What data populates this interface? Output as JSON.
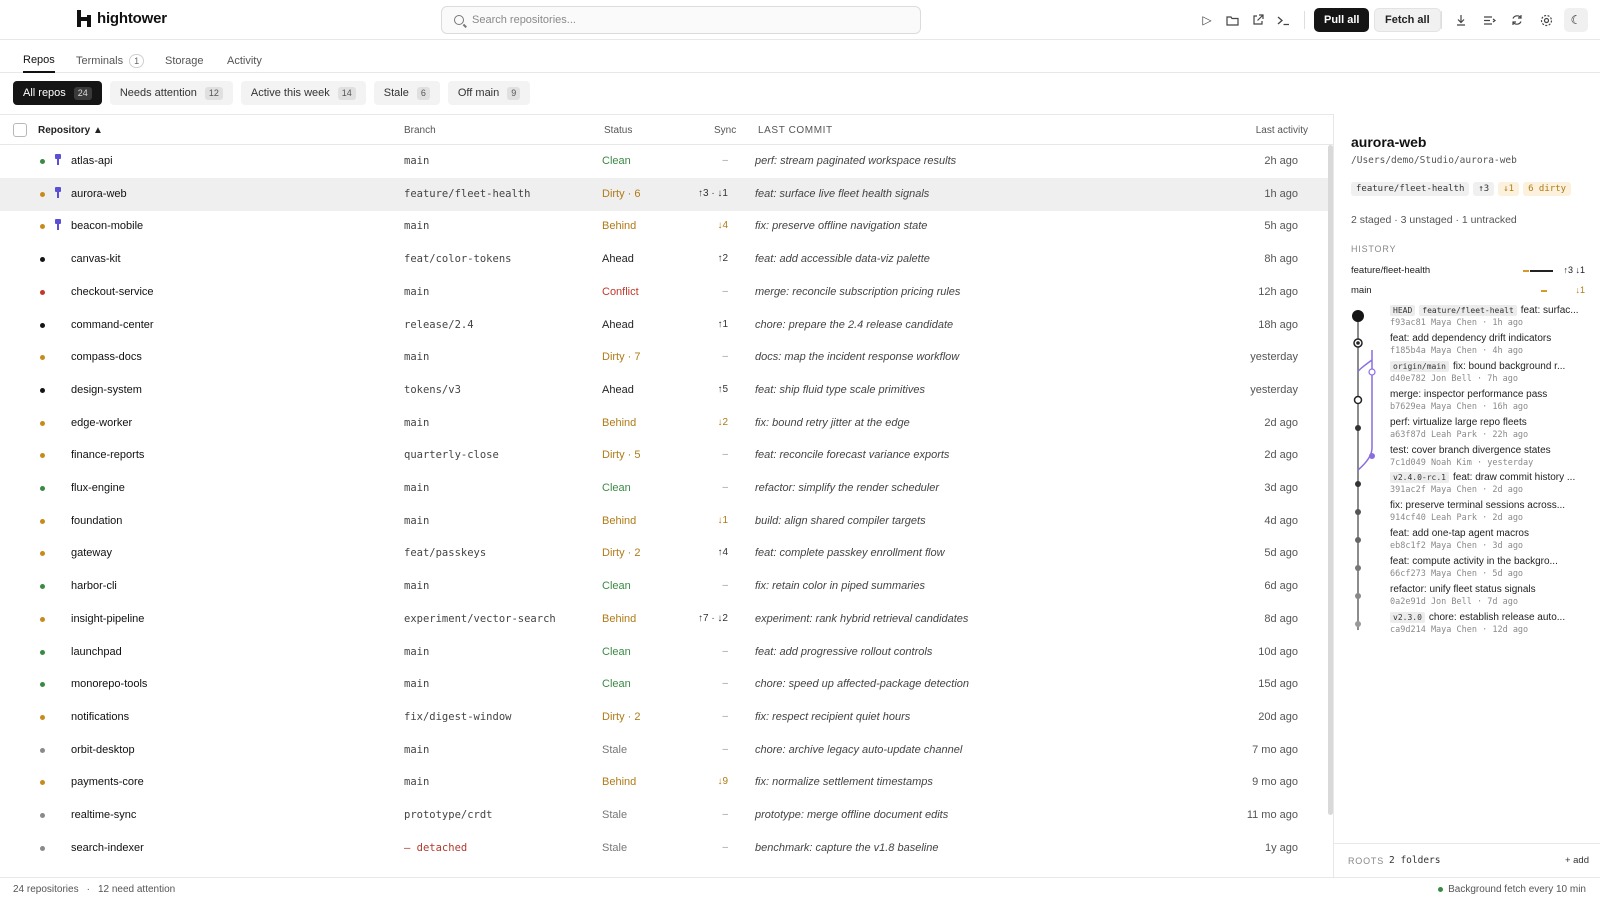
{
  "app": {
    "name": "hightower"
  },
  "search": {
    "placeholder": "Search repositories..."
  },
  "toolbar": {
    "pull_all": "Pull all",
    "fetch_all": "Fetch all",
    "icons": [
      "play-icon",
      "folder-icon",
      "external-link-icon",
      "terminal-icon",
      "download-icon",
      "list-icon",
      "refresh-icon",
      "gear-icon",
      "moon-icon"
    ]
  },
  "tabs": [
    {
      "label": "Repos",
      "active": true,
      "badge": ""
    },
    {
      "label": "Terminals",
      "active": false,
      "badge": "1"
    },
    {
      "label": "Storage",
      "active": false,
      "badge": ""
    },
    {
      "label": "Activity",
      "active": false,
      "badge": ""
    }
  ],
  "filters": [
    {
      "label": "All repos",
      "count": "24",
      "active": true
    },
    {
      "label": "Needs attention",
      "count": "12",
      "active": false
    },
    {
      "label": "Active this week",
      "count": "14",
      "active": false
    },
    {
      "label": "Stale",
      "count": "6",
      "active": false
    },
    {
      "label": "Off main",
      "count": "9",
      "active": false
    }
  ],
  "table": {
    "columns": {
      "repository": "Repository ▲",
      "branch": "Branch",
      "status": "Status",
      "sync": "Sync",
      "last_commit": "LAST COMMIT",
      "last_activity": "Last activity"
    },
    "rows": [
      {
        "name": "atlas-api",
        "pinned": true,
        "dot": "#3a8a44",
        "branch": "main",
        "status": "Clean",
        "kind": "clean",
        "sync": "–",
        "message": "perf: stream paginated workspace results",
        "activity": "2h ago"
      },
      {
        "name": "aurora-web",
        "pinned": true,
        "dot": "#c98a1c",
        "branch": "feature/fleet-health",
        "status": "Dirty · 6",
        "kind": "dirty",
        "sync": "↑3 · ↓1",
        "message": "feat: surface live fleet health signals",
        "activity": "1h ago",
        "selected": true
      },
      {
        "name": "beacon-mobile",
        "pinned": true,
        "dot": "#c98a1c",
        "branch": "main",
        "status": "Behind",
        "kind": "behind",
        "sync": "↓4",
        "message": "fix: preserve offline navigation state",
        "activity": "5h ago"
      },
      {
        "name": "canvas-kit",
        "pinned": false,
        "dot": "#151515",
        "branch": "feat/color-tokens",
        "status": "Ahead",
        "kind": "ahead",
        "sync": "↑2",
        "message": "feat: add accessible data-viz palette",
        "activity": "8h ago"
      },
      {
        "name": "checkout-service",
        "pinned": false,
        "dot": "#c0392b",
        "branch": "main",
        "status": "Conflict",
        "kind": "conflict",
        "sync": "–",
        "message": "merge: reconcile subscription pricing rules",
        "activity": "12h ago"
      },
      {
        "name": "command-center",
        "pinned": false,
        "dot": "#151515",
        "branch": "release/2.4",
        "status": "Ahead",
        "kind": "ahead",
        "sync": "↑1",
        "message": "chore: prepare the 2.4 release candidate",
        "activity": "18h ago"
      },
      {
        "name": "compass-docs",
        "pinned": false,
        "dot": "#c98a1c",
        "branch": "main",
        "status": "Dirty · 7",
        "kind": "dirty",
        "sync": "–",
        "message": "docs: map the incident response workflow",
        "activity": "yesterday"
      },
      {
        "name": "design-system",
        "pinned": false,
        "dot": "#151515",
        "branch": "tokens/v3",
        "status": "Ahead",
        "kind": "ahead",
        "sync": "↑5",
        "message": "feat: ship fluid type scale primitives",
        "activity": "yesterday"
      },
      {
        "name": "edge-worker",
        "pinned": false,
        "dot": "#c98a1c",
        "branch": "main",
        "status": "Behind",
        "kind": "behind",
        "sync": "↓2",
        "message": "fix: bound retry jitter at the edge",
        "activity": "2d ago"
      },
      {
        "name": "finance-reports",
        "pinned": false,
        "dot": "#c98a1c",
        "branch": "quarterly-close",
        "status": "Dirty · 5",
        "kind": "dirty",
        "sync": "–",
        "message": "feat: reconcile forecast variance exports",
        "activity": "2d ago"
      },
      {
        "name": "flux-engine",
        "pinned": false,
        "dot": "#3a8a44",
        "branch": "main",
        "status": "Clean",
        "kind": "clean",
        "sync": "–",
        "message": "refactor: simplify the render scheduler",
        "activity": "3d ago"
      },
      {
        "name": "foundation",
        "pinned": false,
        "dot": "#c98a1c",
        "branch": "main",
        "status": "Behind",
        "kind": "behind",
        "sync": "↓1",
        "message": "build: align shared compiler targets",
        "activity": "4d ago"
      },
      {
        "name": "gateway",
        "pinned": false,
        "dot": "#c98a1c",
        "branch": "feat/passkeys",
        "status": "Dirty · 2",
        "kind": "dirty",
        "sync": "↑4",
        "message": "feat: complete passkey enrollment flow",
        "activity": "5d ago"
      },
      {
        "name": "harbor-cli",
        "pinned": false,
        "dot": "#3a8a44",
        "branch": "main",
        "status": "Clean",
        "kind": "clean",
        "sync": "–",
        "message": "fix: retain color in piped summaries",
        "activity": "6d ago"
      },
      {
        "name": "insight-pipeline",
        "pinned": false,
        "dot": "#c98a1c",
        "branch": "experiment/vector-search",
        "status": "Behind",
        "kind": "behind",
        "sync": "↑7 · ↓2",
        "message": "experiment: rank hybrid retrieval candidates",
        "activity": "8d ago"
      },
      {
        "name": "launchpad",
        "pinned": false,
        "dot": "#3a8a44",
        "branch": "main",
        "status": "Clean",
        "kind": "clean",
        "sync": "–",
        "message": "feat: add progressive rollout controls",
        "activity": "10d ago"
      },
      {
        "name": "monorepo-tools",
        "pinned": false,
        "dot": "#3a8a44",
        "branch": "main",
        "status": "Clean",
        "kind": "clean",
        "sync": "–",
        "message": "chore: speed up affected-package detection",
        "activity": "15d ago"
      },
      {
        "name": "notifications",
        "pinned": false,
        "dot": "#c98a1c",
        "branch": "fix/digest-window",
        "status": "Dirty · 2",
        "kind": "dirty",
        "sync": "–",
        "message": "fix: respect recipient quiet hours",
        "activity": "20d ago"
      },
      {
        "name": "orbit-desktop",
        "pinned": false,
        "dot": "#8a8a8a",
        "branch": "main",
        "status": "Stale",
        "kind": "stale",
        "sync": "–",
        "message": "chore: archive legacy auto-update channel",
        "activity": "7 mo ago"
      },
      {
        "name": "payments-core",
        "pinned": false,
        "dot": "#c98a1c",
        "branch": "main",
        "status": "Behind",
        "kind": "behind",
        "sync": "↓9",
        "message": "fix: normalize settlement timestamps",
        "activity": "9 mo ago"
      },
      {
        "name": "realtime-sync",
        "pinned": false,
        "dot": "#8a8a8a",
        "branch": "prototype/crdt",
        "status": "Stale",
        "kind": "stale",
        "sync": "–",
        "message": "prototype: merge offline document edits",
        "activity": "11 mo ago"
      },
      {
        "name": "search-indexer",
        "pinned": false,
        "dot": "#8a8a8a",
        "branch": "— detached",
        "detached": true,
        "status": "Stale",
        "kind": "stale",
        "sync": "–",
        "message": "benchmark: capture the v1.8 baseline",
        "activity": "1y ago"
      }
    ]
  },
  "panel": {
    "title": "aurora-web",
    "path": "/Users/demo/Studio/aurora-web",
    "tags": [
      {
        "label": "feature/fleet-health",
        "warn": false
      },
      {
        "label": "↑3",
        "warn": false
      },
      {
        "label": "↓1",
        "warn": true
      },
      {
        "label": "6 dirty",
        "warn": true
      }
    ],
    "counts": "2 staged · 3 unstaged · 1 untracked",
    "history_label": "HISTORY",
    "branches": [
      {
        "name": "feature/fleet-health",
        "value": "↑3 ↓1"
      },
      {
        "name": "main",
        "value": "↓1"
      }
    ],
    "commits": [
      {
        "tags": [
          "HEAD",
          "feature/fleet-healt"
        ],
        "message": "feat: surfac...",
        "meta": "f93ac81  Maya Chen · 1h ago"
      },
      {
        "tags": [],
        "message": "feat: add dependency drift indicators",
        "meta": "f185b4a  Maya Chen · 4h ago"
      },
      {
        "tags": [
          "origin/main"
        ],
        "message": "fix: bound background r...",
        "meta": "d40e782  Jon Bell · 7h ago"
      },
      {
        "tags": [],
        "message": "merge: inspector performance pass",
        "meta": "b7629ea  Maya Chen · 16h ago"
      },
      {
        "tags": [],
        "message": "perf: virtualize large repo fleets",
        "meta": "a63f87d  Leah Park · 22h ago"
      },
      {
        "tags": [],
        "message": "test: cover branch divergence states",
        "meta": "7c1d049  Noah Kim · yesterday"
      },
      {
        "tags": [
          "v2.4.0-rc.1"
        ],
        "message": "feat: draw commit history ...",
        "meta": "391ac2f  Maya Chen · 2d ago"
      },
      {
        "tags": [],
        "message": "fix: preserve terminal sessions across...",
        "meta": "914cf40  Leah Park · 2d ago"
      },
      {
        "tags": [],
        "message": "feat: add one-tap agent macros",
        "meta": "eb8c1f2  Maya Chen · 3d ago"
      },
      {
        "tags": [],
        "message": "feat: compute activity in the backgro...",
        "meta": "66cf273  Maya Chen · 5d ago"
      },
      {
        "tags": [],
        "message": "refactor: unify fleet status signals",
        "meta": "0a2e91d  Jon Bell · 7d ago"
      },
      {
        "tags": [
          "v2.3.0"
        ],
        "message": "chore: establish release auto...",
        "meta": "ca9d214  Maya Chen · 12d ago"
      }
    ],
    "roots_label": "ROOTS",
    "roots_value": "2 folders",
    "add_label": "+ add"
  },
  "statusbar": {
    "repos": "24 repositories",
    "sep": "·",
    "attention": "12 need attention",
    "background": "Background fetch every 10 min"
  },
  "colors": {
    "accent": "#151515",
    "clean": "#3a8a44",
    "warn": "#b07a16",
    "conflict": "#c0392b",
    "pin": "#5b4fd6",
    "graph_branch": "#8a6ee0"
  }
}
